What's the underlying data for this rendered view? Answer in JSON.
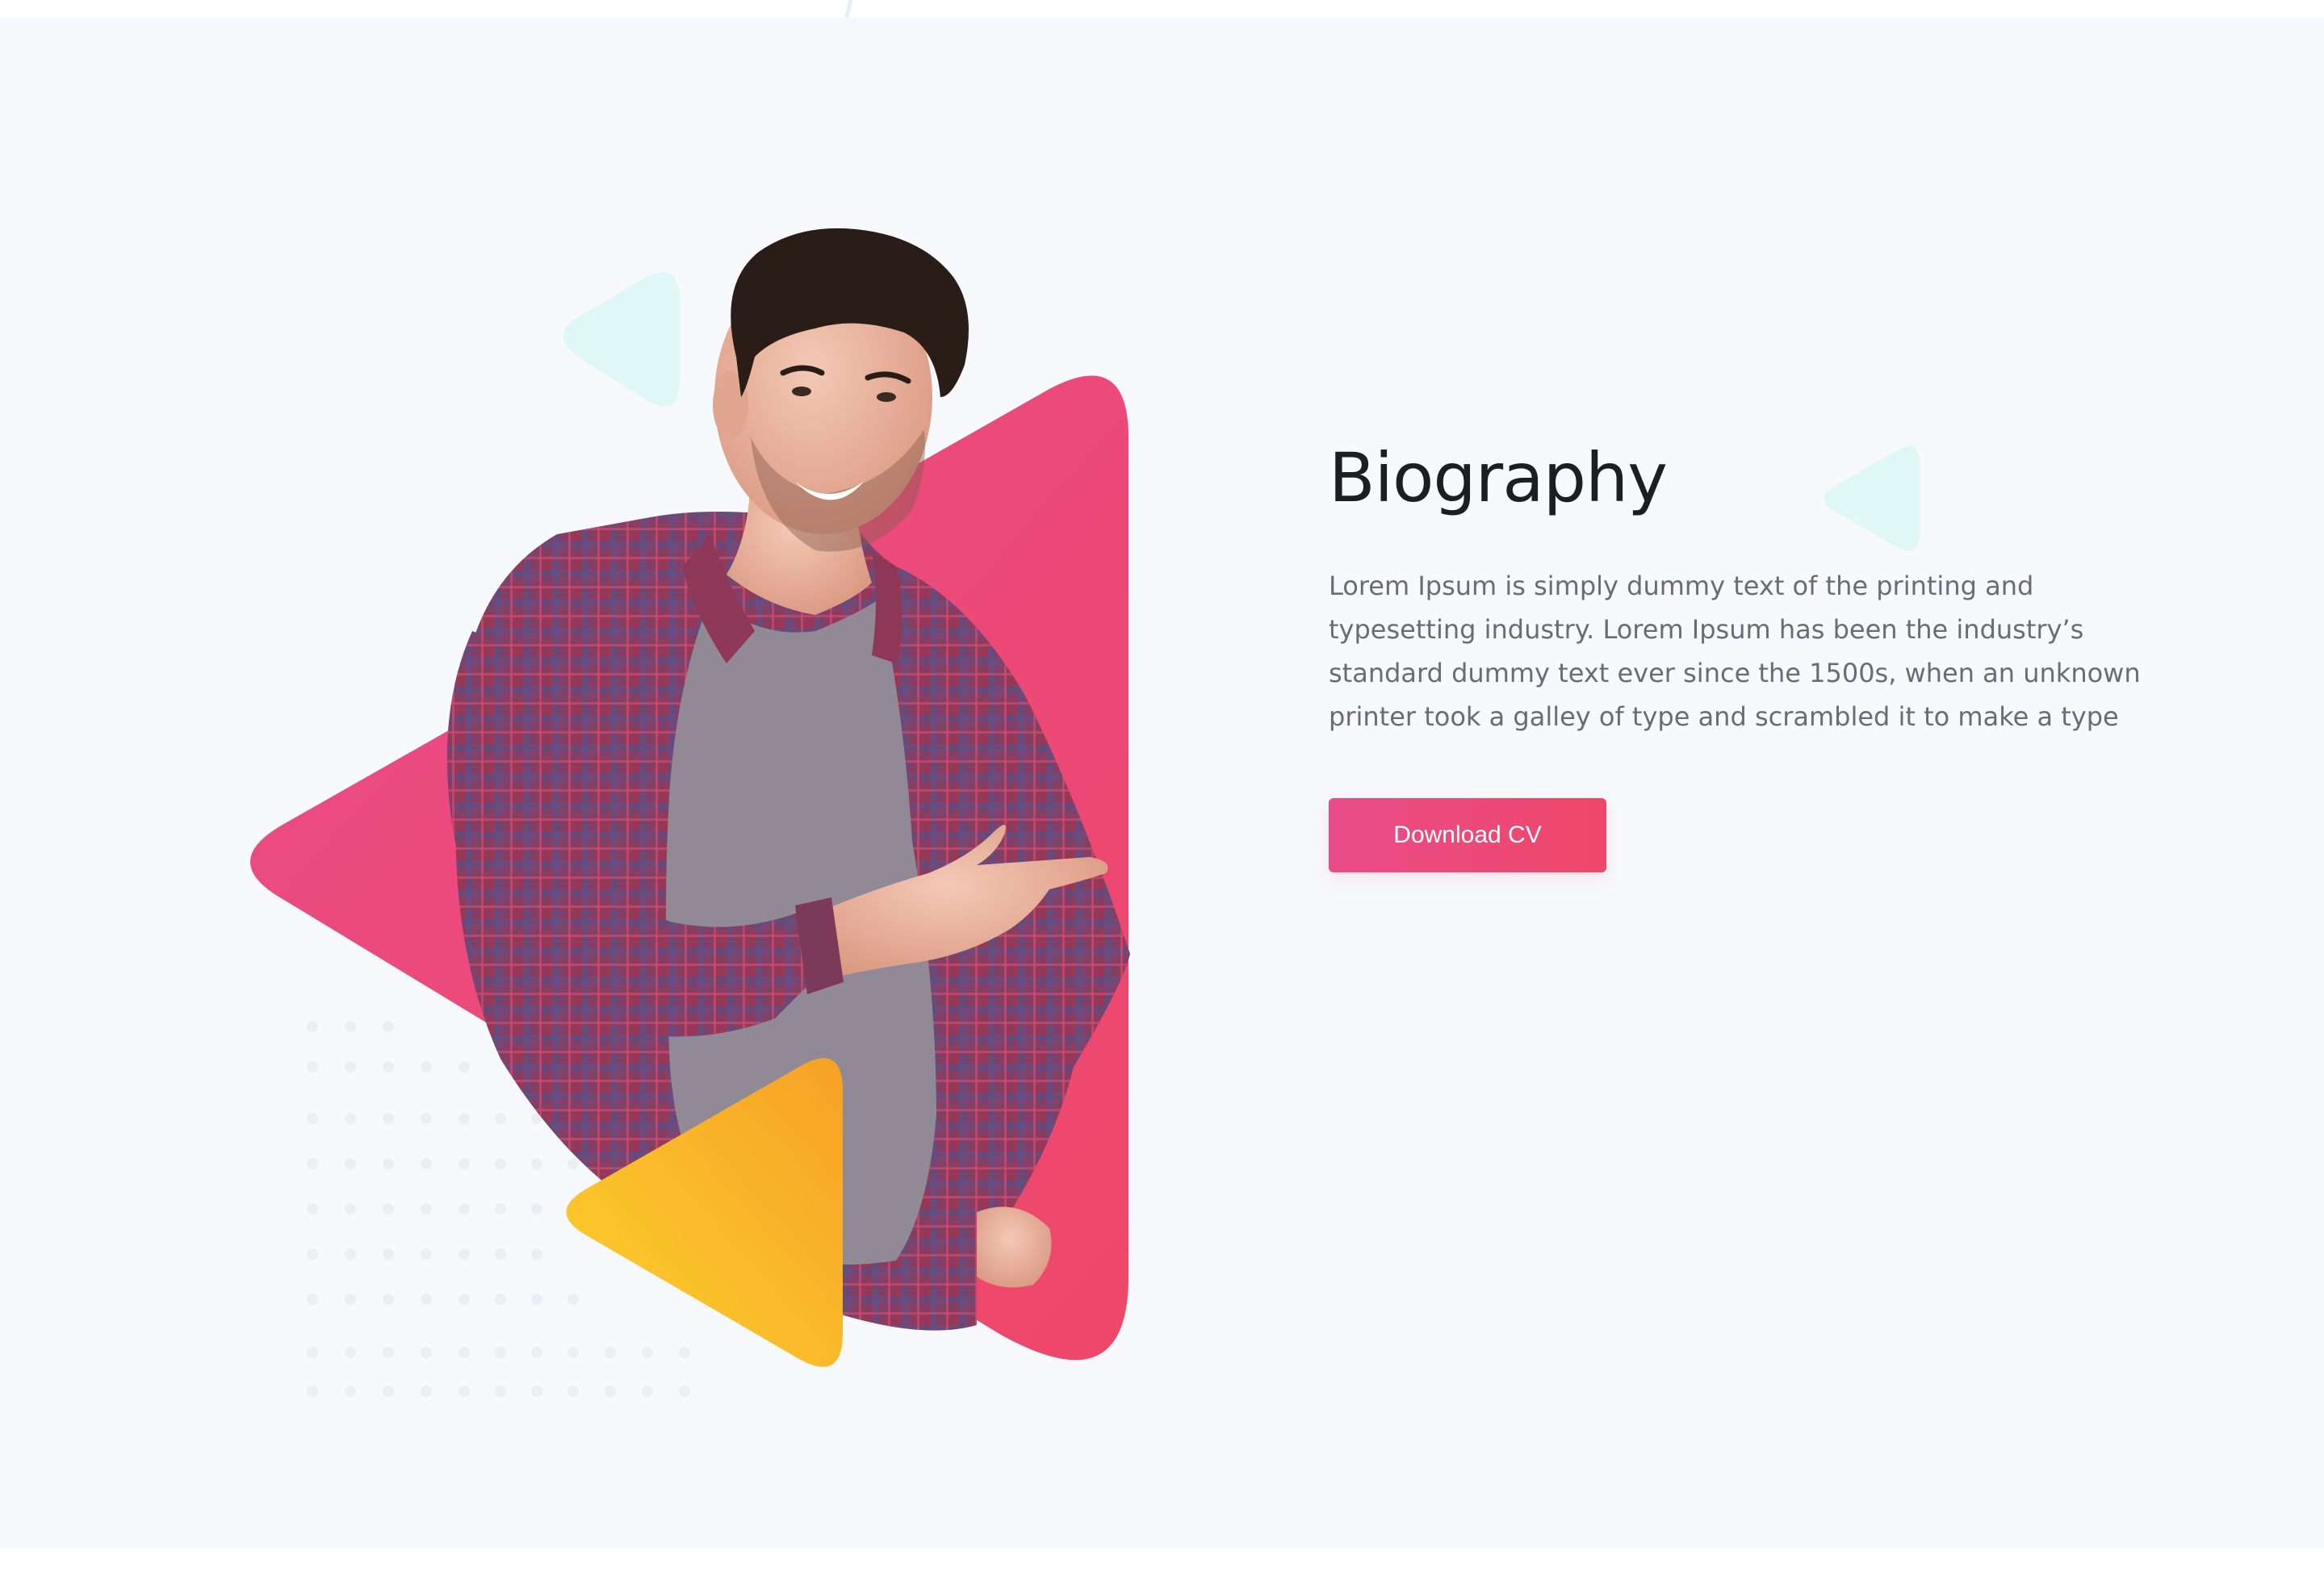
{
  "biography": {
    "title": "Biography",
    "text": "Lorem Ipsum is simply dummy text of the printing and typesetting industry. Lorem Ipsum has been the industry’s standard dummy text ever since the 1500s, when an unknown printer took a galley of type and scrambled it to make a type",
    "button_label": "Download CV"
  },
  "colors": {
    "background": "#f8f9fc",
    "accent_pink": "#ea4c89",
    "accent_red": "#ee4769",
    "accent_yellow": "#fdd22d",
    "accent_orange": "#f6a126",
    "soft_cyan": "#dff8f5",
    "title_text": "#1d1d24",
    "body_text": "#6b6b75"
  },
  "icons": {
    "top_mark": "slash-mark-icon",
    "decor_triangle": "rounded-triangle-icon"
  }
}
